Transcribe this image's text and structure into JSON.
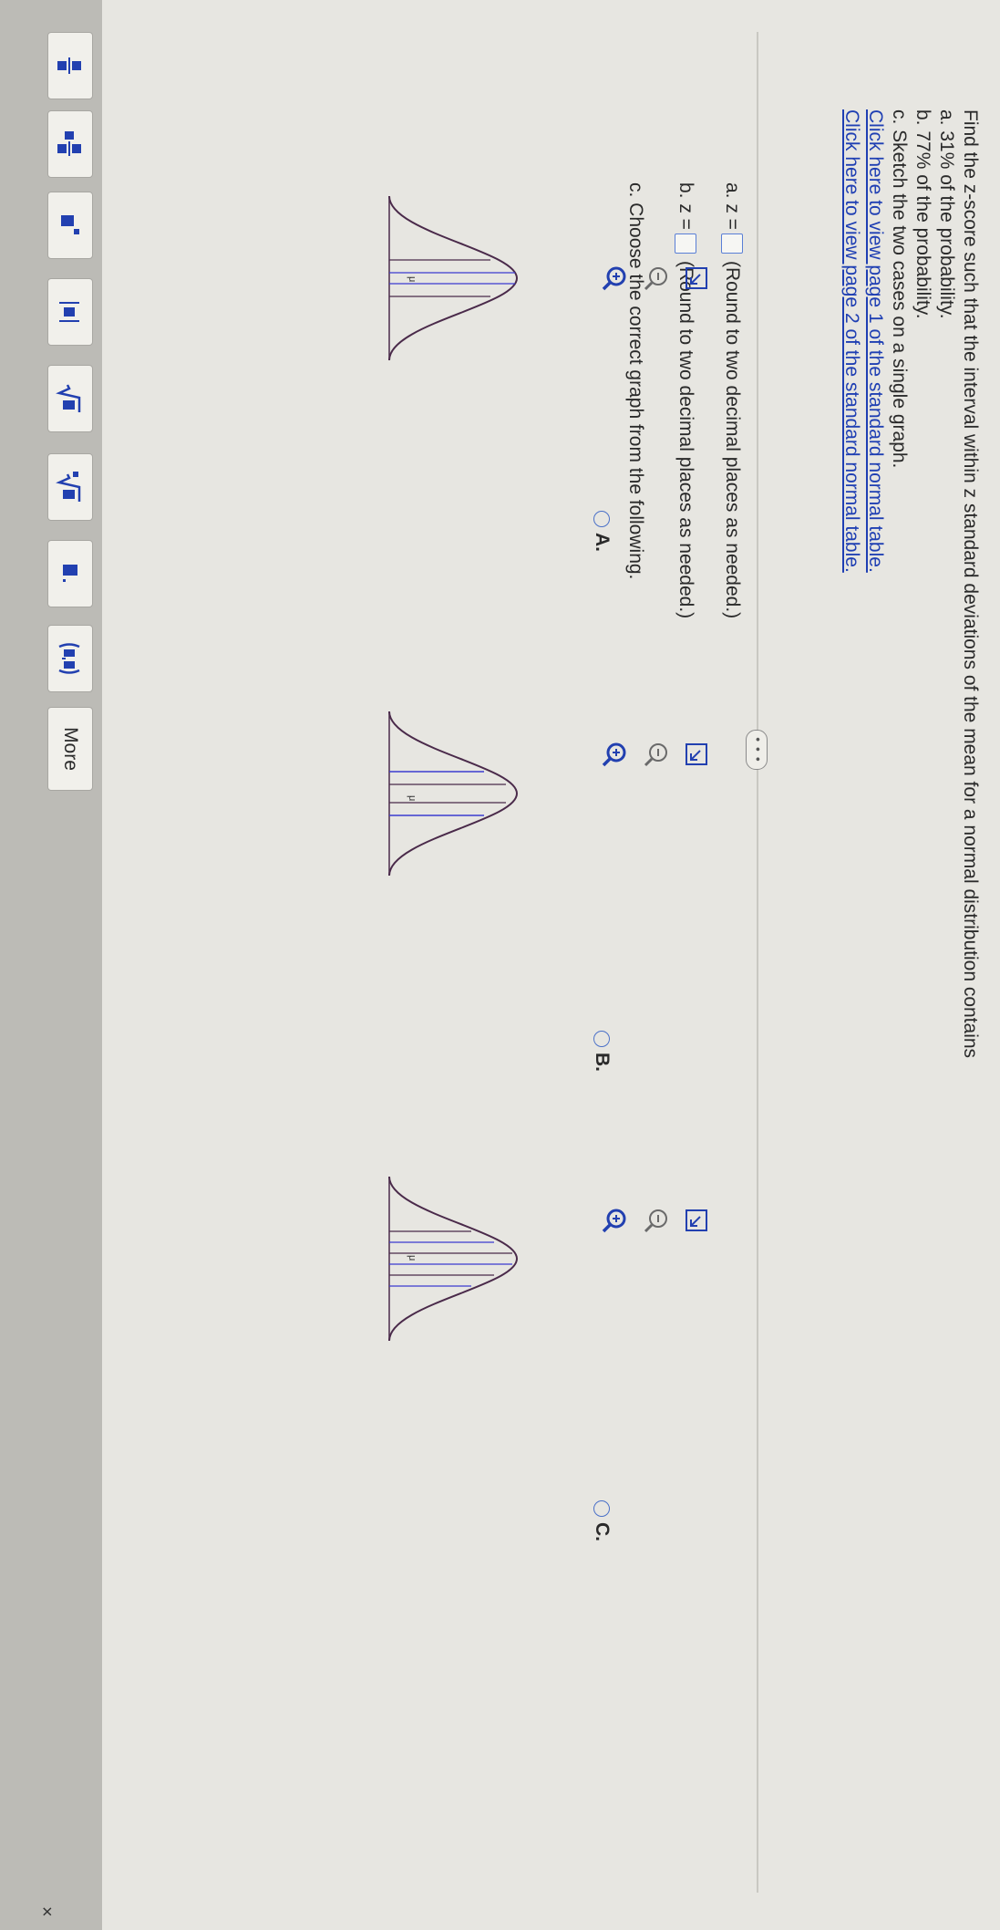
{
  "question": {
    "lines": [
      "Find the z-score such that the interval within z standard deviations of the mean for a normal distribution contains",
      "a. 31% of the probability.",
      "b. 77% of the probability.",
      "c. Sketch the two cases on a single graph."
    ],
    "links": [
      "Click here to view page 1 of the standard normal table.",
      "Click here to view page 2 of the standard normal table."
    ]
  },
  "divider_handle": "• • •",
  "answers": {
    "a": {
      "prefix": "a. z =",
      "hint": "(Round to two decimal places as needed.)",
      "value": ""
    },
    "b": {
      "prefix": "b. z =",
      "hint": "(Round to two decimal places as needed.)",
      "value": ""
    },
    "c": {
      "prompt": "c. Choose the correct graph from the following."
    }
  },
  "options": [
    {
      "label": "A.",
      "mu": "μ",
      "selected": false
    },
    {
      "label": "B.",
      "mu": "μ",
      "selected": false
    },
    {
      "label": "C.",
      "mu": "μ",
      "selected": false
    }
  ],
  "toolbar": {
    "buttons": [
      "fraction-icon",
      "mixed-number-icon",
      "exponent-icon",
      "absolute-value-icon",
      "square-root-icon",
      "nth-root-icon",
      "decimal-icon",
      "ordered-pair-icon"
    ],
    "more_label": "More"
  },
  "close_glyph": "×",
  "colors": {
    "accent": "#2240b0",
    "curve": "#4a2a4a",
    "region": "#3b3bd0"
  }
}
